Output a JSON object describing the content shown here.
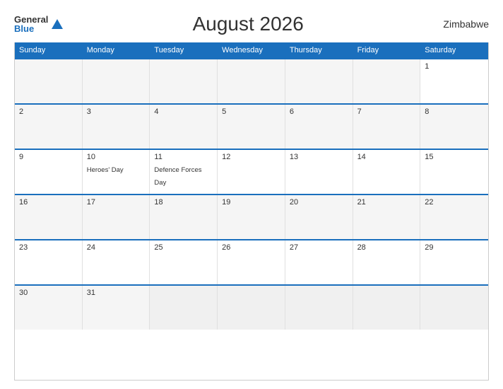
{
  "header": {
    "logo_general": "General",
    "logo_blue": "Blue",
    "title": "August 2026",
    "country": "Zimbabwe"
  },
  "day_headers": [
    "Sunday",
    "Monday",
    "Tuesday",
    "Wednesday",
    "Thursday",
    "Friday",
    "Saturday"
  ],
  "weeks": [
    [
      {
        "num": "",
        "empty": true
      },
      {
        "num": "",
        "empty": true
      },
      {
        "num": "",
        "empty": true
      },
      {
        "num": "",
        "empty": true
      },
      {
        "num": "",
        "empty": true
      },
      {
        "num": "",
        "empty": true
      },
      {
        "num": "1",
        "holiday": ""
      }
    ],
    [
      {
        "num": "2",
        "holiday": ""
      },
      {
        "num": "3",
        "holiday": ""
      },
      {
        "num": "4",
        "holiday": ""
      },
      {
        "num": "5",
        "holiday": ""
      },
      {
        "num": "6",
        "holiday": ""
      },
      {
        "num": "7",
        "holiday": ""
      },
      {
        "num": "8",
        "holiday": ""
      }
    ],
    [
      {
        "num": "9",
        "holiday": ""
      },
      {
        "num": "10",
        "holiday": "Heroes' Day"
      },
      {
        "num": "11",
        "holiday": "Defence Forces Day"
      },
      {
        "num": "12",
        "holiday": ""
      },
      {
        "num": "13",
        "holiday": ""
      },
      {
        "num": "14",
        "holiday": ""
      },
      {
        "num": "15",
        "holiday": ""
      }
    ],
    [
      {
        "num": "16",
        "holiday": ""
      },
      {
        "num": "17",
        "holiday": ""
      },
      {
        "num": "18",
        "holiday": ""
      },
      {
        "num": "19",
        "holiday": ""
      },
      {
        "num": "20",
        "holiday": ""
      },
      {
        "num": "21",
        "holiday": ""
      },
      {
        "num": "22",
        "holiday": ""
      }
    ],
    [
      {
        "num": "23",
        "holiday": ""
      },
      {
        "num": "24",
        "holiday": ""
      },
      {
        "num": "25",
        "holiday": ""
      },
      {
        "num": "26",
        "holiday": ""
      },
      {
        "num": "27",
        "holiday": ""
      },
      {
        "num": "28",
        "holiday": ""
      },
      {
        "num": "29",
        "holiday": ""
      }
    ],
    [
      {
        "num": "30",
        "holiday": ""
      },
      {
        "num": "31",
        "holiday": ""
      },
      {
        "num": "",
        "empty": true
      },
      {
        "num": "",
        "empty": true
      },
      {
        "num": "",
        "empty": true
      },
      {
        "num": "",
        "empty": true
      },
      {
        "num": "",
        "empty": true
      }
    ]
  ]
}
